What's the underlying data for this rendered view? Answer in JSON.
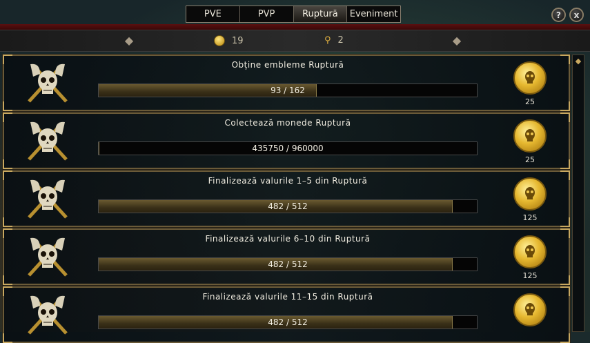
{
  "tabs": [
    {
      "label": "PVE",
      "active": false
    },
    {
      "label": "PVP",
      "active": false
    },
    {
      "label": "Ruptură",
      "active": true
    },
    {
      "label": "Eveniment",
      "active": false
    }
  ],
  "buttons": {
    "help": "?",
    "close": "x"
  },
  "currencies": [
    {
      "icon": "emblem-coin-icon",
      "value": "19"
    },
    {
      "icon": "key-icon",
      "value": "2"
    }
  ],
  "quests": [
    {
      "title": "Obține embleme Ruptură",
      "progress_text": "93 / 162",
      "progress": 0.574,
      "reward": "25"
    },
    {
      "title": "Colectează monede Ruptură",
      "progress_text": "435750 / 960000",
      "progress": 0.0,
      "reward": "25"
    },
    {
      "title": "Finalizează valurile 1–5 din Ruptură",
      "progress_text": "482 / 512",
      "progress": 0.935,
      "reward": "125"
    },
    {
      "title": "Finalizează valurile 6–10 din Ruptură",
      "progress_text": "482 / 512",
      "progress": 0.935,
      "reward": "125"
    },
    {
      "title": "Finalizează valurile 11–15 din Ruptură",
      "progress_text": "482 / 512",
      "progress": 0.935,
      "reward": ""
    }
  ],
  "colors": {
    "accent_gold": "#c8a860",
    "header_red": "#5a1010"
  }
}
